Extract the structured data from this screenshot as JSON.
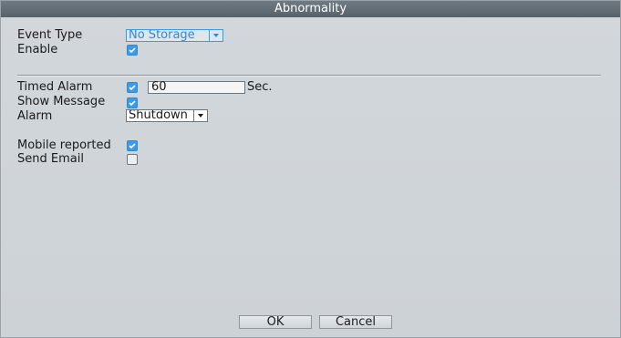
{
  "title": "Abnormality",
  "event_type": {
    "label": "Event Type",
    "value": "No Storage"
  },
  "enable": {
    "label": "Enable",
    "checked": true
  },
  "timed_alarm": {
    "label": "Timed Alarm",
    "checked": true,
    "value": "60",
    "unit": "Sec."
  },
  "show_message": {
    "label": "Show Message",
    "checked": true
  },
  "alarm": {
    "label": "Alarm",
    "value": "Shutdown"
  },
  "mobile_reported": {
    "label": "Mobile reported",
    "checked": true
  },
  "send_email": {
    "label": "Send Email",
    "checked": false
  },
  "buttons": {
    "ok": "OK",
    "cancel": "Cancel"
  },
  "colors": {
    "accent": "#3a9be6",
    "titlebar": "#606a72",
    "panel": "#d0d5d9"
  }
}
